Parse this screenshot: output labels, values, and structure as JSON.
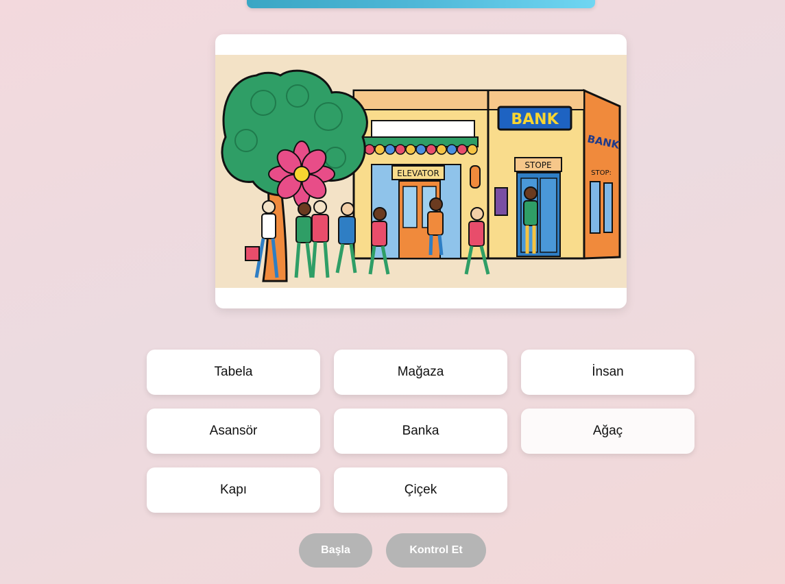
{
  "words": [
    "Tabela",
    "Mağaza",
    "İnsan",
    "Asansör",
    "Banka",
    "Ağaç",
    "Kapı",
    "Çiçek"
  ],
  "buttons": {
    "start": "Başla",
    "check": "Kontrol Et"
  },
  "scene_signs": {
    "bank_main": "BANK",
    "bank_side": "BANK",
    "elevator": "ELEVATOR",
    "store": "STOPE",
    "store_side": "STOP:"
  }
}
